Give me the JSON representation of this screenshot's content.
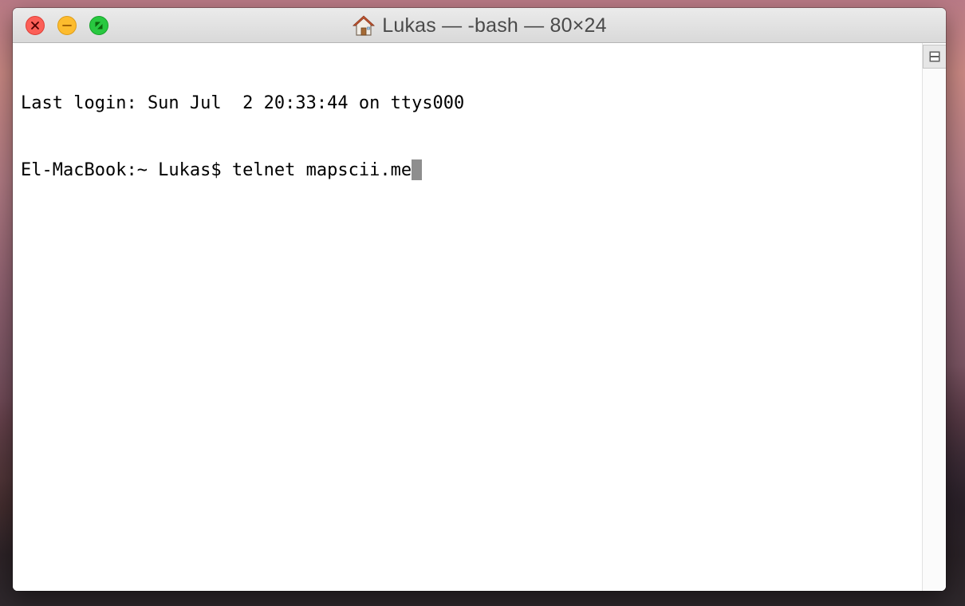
{
  "window": {
    "title": "Lukas — -bash — 80×24",
    "title_icon": "home-folder-icon"
  },
  "traffic_lights": {
    "close": {
      "icon": "close-icon",
      "color": "#fc5f57"
    },
    "minimize": {
      "icon": "minimize-icon",
      "color": "#fdbc2e"
    },
    "zoom": {
      "icon": "fullscreen-icon",
      "color": "#28c840"
    }
  },
  "terminal": {
    "lines": [
      "Last login: Sun Jul  2 20:33:44 on ttys000",
      "El-MacBook:~ Lukas$ telnet mapscii.me"
    ],
    "cursor_color": "#8e8e8e"
  },
  "scrollbar": {
    "split_icon": "split-pane-icon"
  }
}
